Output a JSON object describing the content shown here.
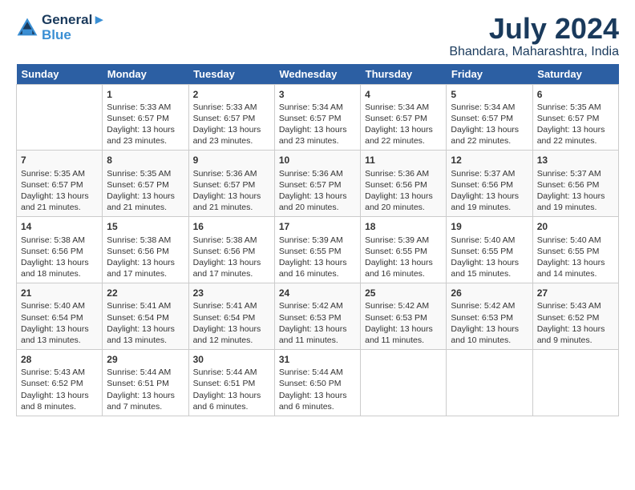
{
  "logo": {
    "line1": "General",
    "line2": "Blue"
  },
  "title": "July 2024",
  "subtitle": "Bhandara, Maharashtra, India",
  "days_of_week": [
    "Sunday",
    "Monday",
    "Tuesday",
    "Wednesday",
    "Thursday",
    "Friday",
    "Saturday"
  ],
  "weeks": [
    [
      {
        "day": "",
        "content": ""
      },
      {
        "day": "1",
        "content": "Sunrise: 5:33 AM\nSunset: 6:57 PM\nDaylight: 13 hours\nand 23 minutes."
      },
      {
        "day": "2",
        "content": "Sunrise: 5:33 AM\nSunset: 6:57 PM\nDaylight: 13 hours\nand 23 minutes."
      },
      {
        "day": "3",
        "content": "Sunrise: 5:34 AM\nSunset: 6:57 PM\nDaylight: 13 hours\nand 23 minutes."
      },
      {
        "day": "4",
        "content": "Sunrise: 5:34 AM\nSunset: 6:57 PM\nDaylight: 13 hours\nand 22 minutes."
      },
      {
        "day": "5",
        "content": "Sunrise: 5:34 AM\nSunset: 6:57 PM\nDaylight: 13 hours\nand 22 minutes."
      },
      {
        "day": "6",
        "content": "Sunrise: 5:35 AM\nSunset: 6:57 PM\nDaylight: 13 hours\nand 22 minutes."
      }
    ],
    [
      {
        "day": "7",
        "content": "Sunrise: 5:35 AM\nSunset: 6:57 PM\nDaylight: 13 hours\nand 21 minutes."
      },
      {
        "day": "8",
        "content": "Sunrise: 5:35 AM\nSunset: 6:57 PM\nDaylight: 13 hours\nand 21 minutes."
      },
      {
        "day": "9",
        "content": "Sunrise: 5:36 AM\nSunset: 6:57 PM\nDaylight: 13 hours\nand 21 minutes."
      },
      {
        "day": "10",
        "content": "Sunrise: 5:36 AM\nSunset: 6:57 PM\nDaylight: 13 hours\nand 20 minutes."
      },
      {
        "day": "11",
        "content": "Sunrise: 5:36 AM\nSunset: 6:56 PM\nDaylight: 13 hours\nand 20 minutes."
      },
      {
        "day": "12",
        "content": "Sunrise: 5:37 AM\nSunset: 6:56 PM\nDaylight: 13 hours\nand 19 minutes."
      },
      {
        "day": "13",
        "content": "Sunrise: 5:37 AM\nSunset: 6:56 PM\nDaylight: 13 hours\nand 19 minutes."
      }
    ],
    [
      {
        "day": "14",
        "content": "Sunrise: 5:38 AM\nSunset: 6:56 PM\nDaylight: 13 hours\nand 18 minutes."
      },
      {
        "day": "15",
        "content": "Sunrise: 5:38 AM\nSunset: 6:56 PM\nDaylight: 13 hours\nand 17 minutes."
      },
      {
        "day": "16",
        "content": "Sunrise: 5:38 AM\nSunset: 6:56 PM\nDaylight: 13 hours\nand 17 minutes."
      },
      {
        "day": "17",
        "content": "Sunrise: 5:39 AM\nSunset: 6:55 PM\nDaylight: 13 hours\nand 16 minutes."
      },
      {
        "day": "18",
        "content": "Sunrise: 5:39 AM\nSunset: 6:55 PM\nDaylight: 13 hours\nand 16 minutes."
      },
      {
        "day": "19",
        "content": "Sunrise: 5:40 AM\nSunset: 6:55 PM\nDaylight: 13 hours\nand 15 minutes."
      },
      {
        "day": "20",
        "content": "Sunrise: 5:40 AM\nSunset: 6:55 PM\nDaylight: 13 hours\nand 14 minutes."
      }
    ],
    [
      {
        "day": "21",
        "content": "Sunrise: 5:40 AM\nSunset: 6:54 PM\nDaylight: 13 hours\nand 13 minutes."
      },
      {
        "day": "22",
        "content": "Sunrise: 5:41 AM\nSunset: 6:54 PM\nDaylight: 13 hours\nand 13 minutes."
      },
      {
        "day": "23",
        "content": "Sunrise: 5:41 AM\nSunset: 6:54 PM\nDaylight: 13 hours\nand 12 minutes."
      },
      {
        "day": "24",
        "content": "Sunrise: 5:42 AM\nSunset: 6:53 PM\nDaylight: 13 hours\nand 11 minutes."
      },
      {
        "day": "25",
        "content": "Sunrise: 5:42 AM\nSunset: 6:53 PM\nDaylight: 13 hours\nand 11 minutes."
      },
      {
        "day": "26",
        "content": "Sunrise: 5:42 AM\nSunset: 6:53 PM\nDaylight: 13 hours\nand 10 minutes."
      },
      {
        "day": "27",
        "content": "Sunrise: 5:43 AM\nSunset: 6:52 PM\nDaylight: 13 hours\nand 9 minutes."
      }
    ],
    [
      {
        "day": "28",
        "content": "Sunrise: 5:43 AM\nSunset: 6:52 PM\nDaylight: 13 hours\nand 8 minutes."
      },
      {
        "day": "29",
        "content": "Sunrise: 5:44 AM\nSunset: 6:51 PM\nDaylight: 13 hours\nand 7 minutes."
      },
      {
        "day": "30",
        "content": "Sunrise: 5:44 AM\nSunset: 6:51 PM\nDaylight: 13 hours\nand 6 minutes."
      },
      {
        "day": "31",
        "content": "Sunrise: 5:44 AM\nSunset: 6:50 PM\nDaylight: 13 hours\nand 6 minutes."
      },
      {
        "day": "",
        "content": ""
      },
      {
        "day": "",
        "content": ""
      },
      {
        "day": "",
        "content": ""
      }
    ]
  ]
}
